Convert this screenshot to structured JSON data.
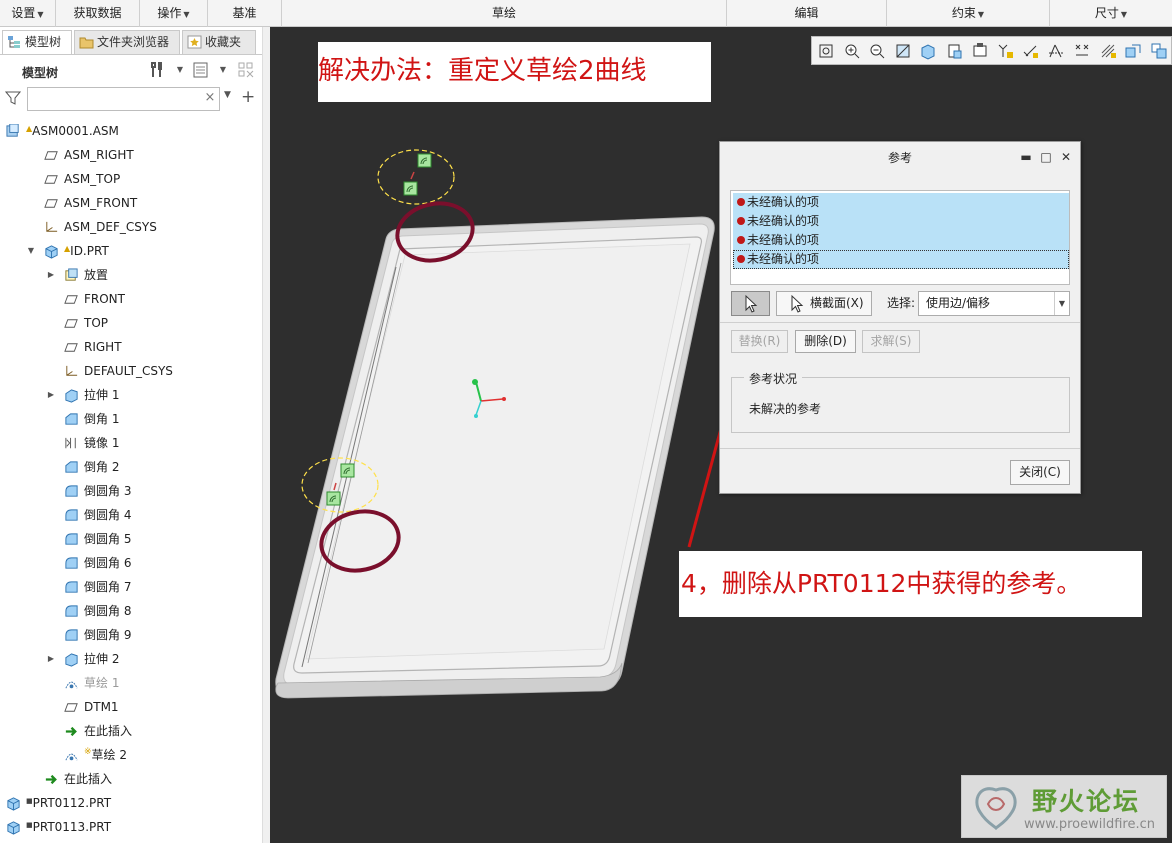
{
  "menubar": {
    "items": [
      {
        "label": "设置",
        "caret": true
      },
      {
        "label": "获取数据",
        "caret": false
      },
      {
        "label": "操作",
        "caret": true
      },
      {
        "label": "基准",
        "caret": false
      },
      {
        "label": "草绘",
        "caret": false
      },
      {
        "label": "编辑",
        "caret": false
      },
      {
        "label": "约束",
        "caret": true
      },
      {
        "label": "尺寸",
        "caret": true
      }
    ]
  },
  "panel": {
    "tabs": [
      {
        "label": "模型树",
        "icon": "model-tree-icon"
      },
      {
        "label": "文件夹浏览器",
        "icon": "folder-browser-icon"
      },
      {
        "label": "收藏夹",
        "icon": "favorites-icon"
      }
    ],
    "tree_header": "模型树",
    "filter_placeholder": ""
  },
  "tree": [
    {
      "label": "ASM0001.ASM",
      "icon": "assembly-icon",
      "mark": "▲",
      "mark_type": "tri"
    },
    {
      "label": "ASM_RIGHT",
      "icon": "datum-plane-icon"
    },
    {
      "label": "ASM_TOP",
      "icon": "datum-plane-icon"
    },
    {
      "label": "ASM_FRONT",
      "icon": "datum-plane-icon"
    },
    {
      "label": "ASM_DEF_CSYS",
      "icon": "csys-icon"
    },
    {
      "label": "ID.PRT",
      "icon": "part-icon",
      "mark": "▲",
      "mark_type": "tri"
    },
    {
      "label": "放置",
      "icon": "placement-icon"
    },
    {
      "label": "FRONT",
      "icon": "datum-plane-icon"
    },
    {
      "label": "TOP",
      "icon": "datum-plane-icon"
    },
    {
      "label": "RIGHT",
      "icon": "datum-plane-icon"
    },
    {
      "label": "DEFAULT_CSYS",
      "icon": "csys-icon"
    },
    {
      "label": "拉伸 1",
      "icon": "extrude-icon"
    },
    {
      "label": "倒角 1",
      "icon": "chamfer-icon"
    },
    {
      "label": "镜像 1",
      "icon": "mirror-icon"
    },
    {
      "label": "倒角 2",
      "icon": "chamfer-icon"
    },
    {
      "label": "倒圆角 3",
      "icon": "round-icon"
    },
    {
      "label": "倒圆角 4",
      "icon": "round-icon"
    },
    {
      "label": "倒圆角 5",
      "icon": "round-icon"
    },
    {
      "label": "倒圆角 6",
      "icon": "round-icon"
    },
    {
      "label": "倒圆角 7",
      "icon": "round-icon"
    },
    {
      "label": "倒圆角 8",
      "icon": "round-icon"
    },
    {
      "label": "倒圆角 9",
      "icon": "round-icon"
    },
    {
      "label": "拉伸 2",
      "icon": "extrude-icon"
    },
    {
      "label": "草绘 1",
      "icon": "sketch-icon"
    },
    {
      "label": "DTM1",
      "icon": "datum-plane-icon"
    },
    {
      "label": "在此插入",
      "icon": "insert-here-icon"
    },
    {
      "label": "草绘 2",
      "icon": "sketch-icon",
      "mark": "※",
      "mark_type": "star"
    },
    {
      "label": "在此插入",
      "icon": "insert-here-icon"
    },
    {
      "label": "PRT0112.PRT",
      "icon": "part-icon",
      "mark": "■",
      "mark_type": "sq"
    },
    {
      "label": "PRT0113.PRT",
      "icon": "part-icon",
      "mark": "■",
      "mark_type": "sq"
    }
  ],
  "annotations": {
    "title": "解决办法：重定义草绘2曲线",
    "step": "4，删除从PRT0112中获得的参考。"
  },
  "graphics_toolbar": {
    "icons": [
      "refit-icon",
      "zoom-in-icon",
      "zoom-out-icon",
      "repaint-icon",
      "display-style-icon",
      "saved-orientations-icon",
      "view-manager-icon",
      "datum-display-icon",
      "disp-constraints-icon",
      "disp-dimensions-icon",
      "disp-vertices-icon",
      "disp-grid-icon",
      "sketch-view-icon",
      "disp-overlap-icon"
    ]
  },
  "dialog": {
    "title": "参考",
    "references": [
      "未经确认的项",
      "未经确认的项",
      "未经确认的项",
      "未经确认的项"
    ],
    "section_button": "横截面(X)",
    "select_label": "选择:",
    "select_value": "使用边/偏移",
    "replace_button": "替换(R)",
    "delete_button": "删除(D)",
    "solve_button": "求解(S)",
    "status_group_label": "参考状况",
    "status_text": "未解决的参考",
    "close_button": "关闭(C)"
  },
  "watermark": {
    "name": "野火论坛",
    "url": "www.proewildfire.cn"
  },
  "colors": {
    "annotation_red": "#d01414",
    "selection_blue": "#b9e1f7",
    "viewport_bg": "#2e2e2e",
    "circle_maroon": "#7a0f2c",
    "highlight_yellow": "#ffe14a",
    "brand_green": "#5f9c36"
  }
}
